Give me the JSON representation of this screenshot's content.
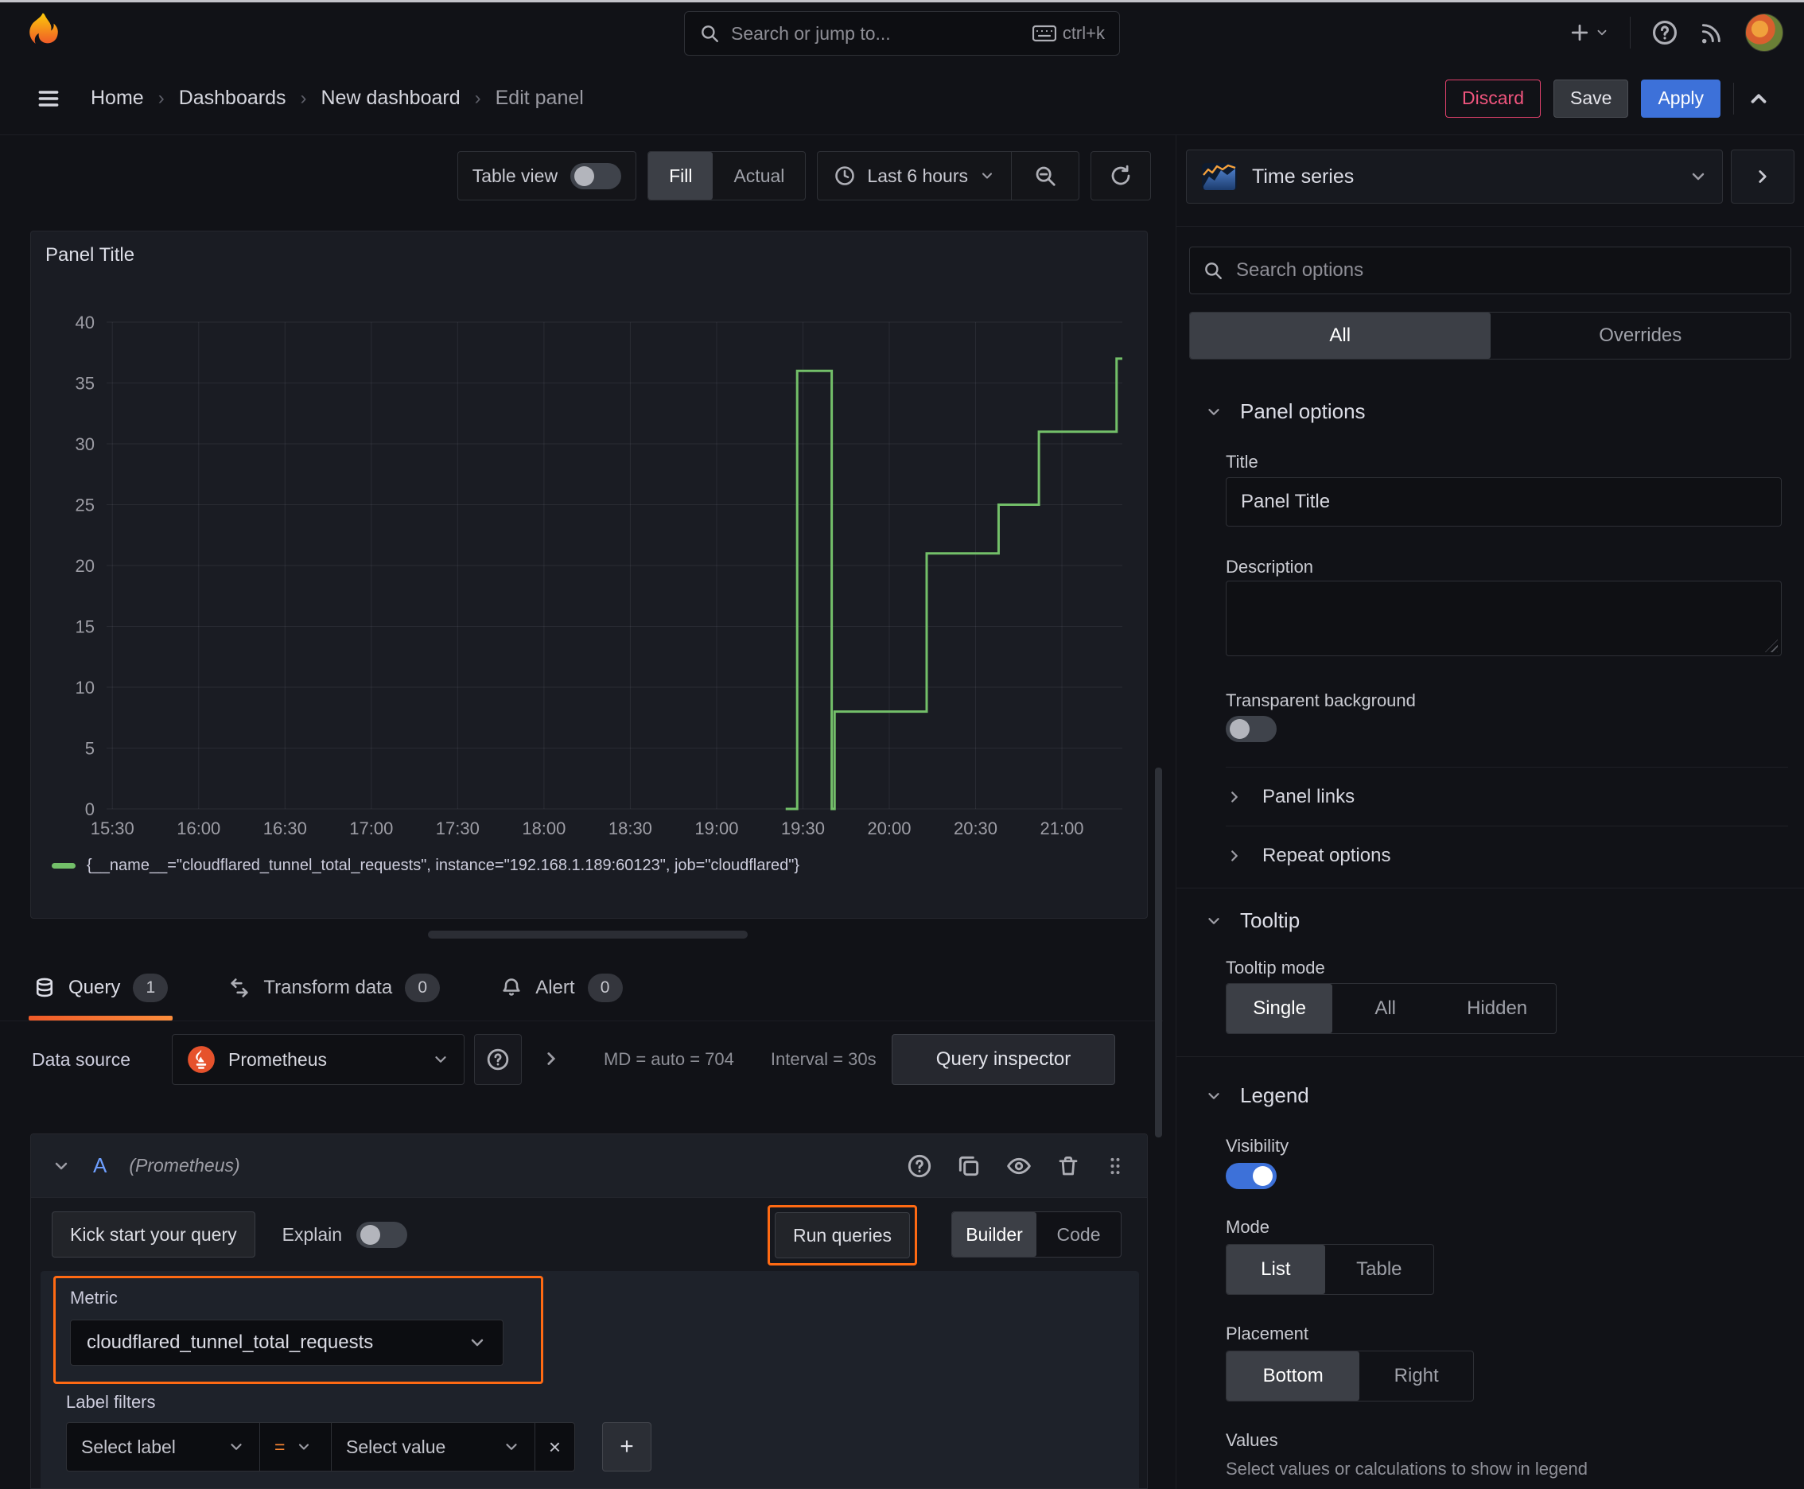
{
  "topbar": {
    "search_placeholder": "Search or jump to...",
    "search_shortcut": "ctrl+k"
  },
  "breadcrumb": {
    "items": [
      "Home",
      "Dashboards",
      "New dashboard",
      "Edit panel"
    ]
  },
  "actions": {
    "discard": "Discard",
    "save": "Save",
    "apply": "Apply"
  },
  "viz_toolbar": {
    "table_view_label": "Table view",
    "table_view_on": false,
    "display_modes": [
      "Fill",
      "Actual"
    ],
    "display_mode_selected": "Fill",
    "time_range": "Last 6 hours"
  },
  "chart_data": {
    "type": "line",
    "variant": "step-after",
    "title": "Panel Title",
    "x_ticks": [
      "15:30",
      "16:00",
      "16:30",
      "17:00",
      "17:30",
      "18:00",
      "18:30",
      "19:00",
      "19:30",
      "20:00",
      "20:30",
      "21:00"
    ],
    "y_ticks": [
      0,
      5,
      10,
      15,
      20,
      25,
      30,
      35,
      40
    ],
    "ylim": [
      0,
      40
    ],
    "x_range_minutes": [
      928,
      1281
    ],
    "grid": true,
    "legend_position": "bottom",
    "series": [
      {
        "name": "{__name__=\"cloudflared_tunnel_total_requests\", instance=\"192.168.1.189:60123\", job=\"cloudflared\"}",
        "color": "#73bf69",
        "points": [
          [
            "19:24",
            0
          ],
          [
            "19:28",
            36
          ],
          [
            "19:39",
            36
          ],
          [
            "19:40",
            0
          ],
          [
            "19:41",
            8
          ],
          [
            "20:12",
            8
          ],
          [
            "20:13",
            21
          ],
          [
            "20:37",
            21
          ],
          [
            "20:38",
            25
          ],
          [
            "20:51",
            25
          ],
          [
            "20:52",
            31
          ],
          [
            "21:18",
            31
          ],
          [
            "21:19",
            37
          ]
        ]
      }
    ]
  },
  "query_tabs": [
    {
      "label": "Query",
      "badge": "1"
    },
    {
      "label": "Transform data",
      "badge": "0"
    },
    {
      "label": "Alert",
      "badge": "0"
    }
  ],
  "datasource_bar": {
    "label": "Data source",
    "name": "Prometheus",
    "stats": "MD = auto = 704",
    "interval": "Interval = 30s",
    "query_inspector": "Query inspector"
  },
  "query_editor": {
    "ref_id": "A",
    "datasource_hint": "(Prometheus)",
    "kick_start": "Kick start your query",
    "explain_label": "Explain",
    "explain_on": false,
    "run_queries": "Run queries",
    "editor_modes": [
      "Builder",
      "Code"
    ],
    "editor_mode_selected": "Builder",
    "metric_label": "Metric",
    "metric_value": "cloudflared_tunnel_total_requests",
    "label_filters_label": "Label filters",
    "select_label_placeholder": "Select label",
    "operator": "=",
    "select_value_placeholder": "Select value",
    "remove_filter": "×",
    "add_filter": "+"
  },
  "options_pane": {
    "visualization": "Time series",
    "search_placeholder": "Search options",
    "filter_tabs": [
      "All",
      "Overrides"
    ],
    "filter_selected": "All",
    "panel_options": {
      "heading": "Panel options",
      "title_label": "Title",
      "title_value": "Panel Title",
      "description_label": "Description",
      "description_value": "",
      "transparent_label": "Transparent background",
      "transparent_on": false,
      "links_label": "Panel links",
      "repeat_label": "Repeat options"
    },
    "tooltip": {
      "heading": "Tooltip",
      "mode_label": "Tooltip mode",
      "modes": [
        "Single",
        "All",
        "Hidden"
      ],
      "mode_selected": "Single"
    },
    "legend": {
      "heading": "Legend",
      "visibility_label": "Visibility",
      "visibility_on": true,
      "mode_label": "Mode",
      "modes": [
        "List",
        "Table"
      ],
      "mode_selected": "List",
      "placement_label": "Placement",
      "placements": [
        "Bottom",
        "Right"
      ],
      "placement_selected": "Bottom",
      "values_label": "Values",
      "values_hint": "Select values or calculations to show in legend"
    }
  },
  "colors": {
    "accent_orange": "#ff6a13",
    "series_green": "#73bf69",
    "apply_blue": "#3d71d9",
    "discard_red": "#f1557e",
    "tab_underline": "#f05a28"
  },
  "icons": {
    "grafana-logo": "flame",
    "search-icon": "magnifier",
    "keyboard-icon": "keyboard",
    "add-new-icon": "plus-chevron",
    "help-icon": "question-circle",
    "news-icon": "rss",
    "user-avatar": "avatar-circle",
    "menu-icon": "hamburger",
    "collapse-icon": "chevron-up",
    "clock-icon": "clock",
    "zoom-out-icon": "magnifier-minus",
    "refresh-icon": "circular-arrow",
    "query-tab-icon": "database",
    "transform-tab-icon": "swap-arrows",
    "alert-tab-icon": "bell",
    "duplicate-icon": "copy",
    "hide-icon": "eye",
    "remove-icon": "trash",
    "drag-icon": "grip-dots",
    "viz-icon": "area-chart-thumbnail",
    "pane-collapse-icon": "chevron-right"
  }
}
